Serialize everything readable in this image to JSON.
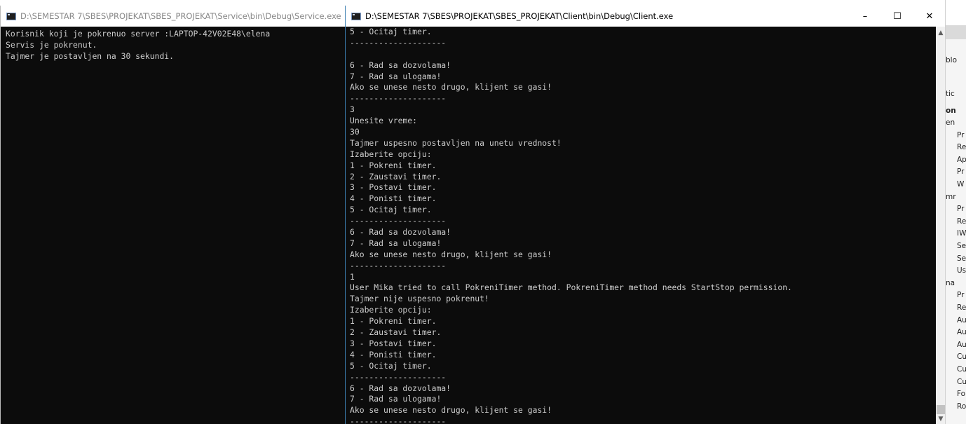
{
  "service_window": {
    "title": "D:\\SEMESTAR 7\\SBES\\PROJEKAT\\SBES_PROJEKAT\\Service\\bin\\Debug\\Service.exe",
    "lines": [
      "Korisnik koji je pokrenuo server :LAPTOP-42V02E48\\elena",
      "Servis je pokrenut.",
      "Tajmer je postavljen na 30 sekundi."
    ]
  },
  "client_window": {
    "title": "D:\\SEMESTAR 7\\SBES\\PROJEKAT\\SBES_PROJEKAT\\Client\\bin\\Debug\\Client.exe",
    "controls": {
      "minimize": "–",
      "maximize": "☐",
      "close": "✕"
    },
    "lines": [
      "5 - Ocitaj timer.",
      "--------------------",
      "",
      "6 - Rad sa dozvolama!",
      "7 - Rad sa ulogama!",
      "Ako se unese nesto drugo, klijent se gasi!",
      "--------------------",
      "3",
      "Unesite vreme:",
      "30",
      "Tajmer uspesno postavljen na unetu vrednost!",
      "Izaberite opciju:",
      "1 - Pokreni timer.",
      "2 - Zaustavi timer.",
      "3 - Postavi timer.",
      "4 - Ponisti timer.",
      "5 - Ocitaj timer.",
      "--------------------",
      "6 - Rad sa dozvolama!",
      "7 - Rad sa ulogama!",
      "Ako se unese nesto drugo, klijent se gasi!",
      "--------------------",
      "1",
      "User Mika tried to call PokreniTimer method. PokreniTimer method needs StartStop permission.",
      "Tajmer nije uspesno pokrenut!",
      "Izaberite opciju:",
      "1 - Pokreni timer.",
      "2 - Zaustavi timer.",
      "3 - Postavi timer.",
      "4 - Ponisti timer.",
      "5 - Ocitaj timer.",
      "--------------------",
      "6 - Rad sa dozvolama!",
      "7 - Rad sa ulogama!",
      "Ako se unese nesto drugo, klijent se gasi!",
      "--------------------"
    ]
  },
  "background_window": {
    "items": [
      "blo",
      "tic",
      "on",
      "en",
      "Pr",
      "Re",
      "Ap",
      "Pr",
      "W",
      "mr",
      "Pr",
      "Re",
      "IW",
      "Se",
      "Se",
      "Us",
      "na",
      "Pr",
      "Re",
      "Au",
      "Au",
      "Au",
      "Cu",
      "Cu",
      "Cu",
      "Fo",
      "Ro"
    ]
  },
  "colors": {
    "console_bg": "#0c0c0c",
    "console_text": "#cccccc",
    "titlebar_bg": "#ffffff"
  }
}
